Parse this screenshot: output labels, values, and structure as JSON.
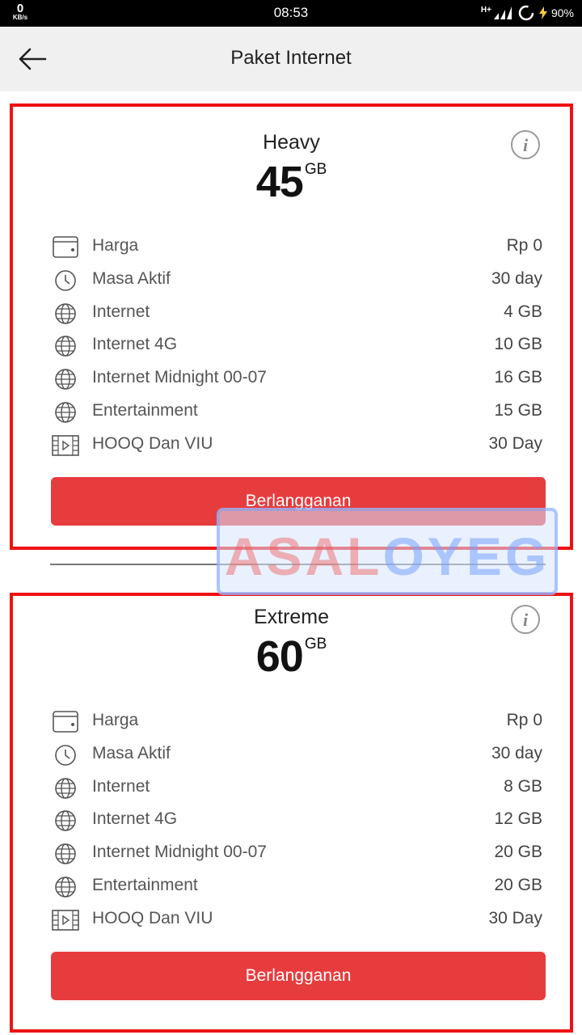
{
  "status_bar": {
    "speed_value": "0",
    "speed_unit": "KB/s",
    "time": "08:53",
    "network": "H+",
    "battery": "90%"
  },
  "app_bar": {
    "title": "Paket Internet",
    "back_icon": "arrow-left-icon"
  },
  "packages": [
    {
      "name": "Heavy",
      "size": "45",
      "unit": "GB",
      "info_icon": "info-icon",
      "rows": [
        {
          "icon": "wallet-icon",
          "label": "Harga",
          "value": "Rp 0"
        },
        {
          "icon": "clock-icon",
          "label": "Masa Aktif",
          "value": "30 day"
        },
        {
          "icon": "globe-icon",
          "label": "Internet",
          "value": "4 GB"
        },
        {
          "icon": "globe-icon",
          "label": "Internet 4G",
          "value": "10 GB"
        },
        {
          "icon": "globe-icon",
          "label": "Internet Midnight 00-07",
          "value": "16 GB"
        },
        {
          "icon": "globe-icon",
          "label": "Entertainment",
          "value": "15 GB"
        },
        {
          "icon": "video-icon",
          "label": "HOOQ Dan VIU",
          "value": "30 Day"
        }
      ],
      "button": "Berlangganan"
    },
    {
      "name": "Extreme",
      "size": "60",
      "unit": "GB",
      "info_icon": "info-icon",
      "rows": [
        {
          "icon": "wallet-icon",
          "label": "Harga",
          "value": "Rp 0"
        },
        {
          "icon": "clock-icon",
          "label": "Masa Aktif",
          "value": "30 day"
        },
        {
          "icon": "globe-icon",
          "label": "Internet",
          "value": "8 GB"
        },
        {
          "icon": "globe-icon",
          "label": "Internet 4G",
          "value": "12 GB"
        },
        {
          "icon": "globe-icon",
          "label": "Internet Midnight 00-07",
          "value": "20 GB"
        },
        {
          "icon": "globe-icon",
          "label": "Entertainment",
          "value": "20 GB"
        },
        {
          "icon": "video-icon",
          "label": "HOOQ Dan VIU",
          "value": "30 Day"
        }
      ],
      "button": "Berlangganan"
    }
  ],
  "watermark": {
    "part1": "ASAL",
    "part2": "OYEG"
  },
  "colors": {
    "accent": "#e73c3e",
    "highlight_border": "#ee1111"
  }
}
